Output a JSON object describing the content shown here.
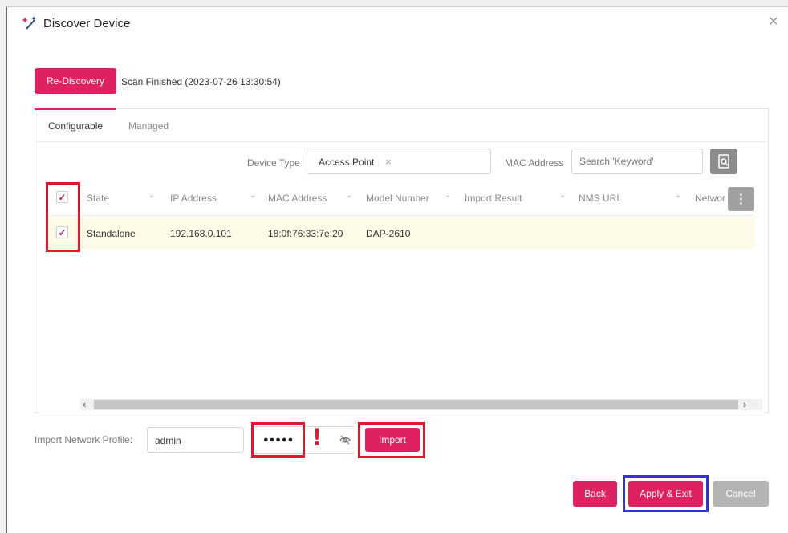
{
  "dialog": {
    "title": "Discover Device",
    "close_icon": "×"
  },
  "rediscovery_label": "Re-Discovery",
  "scan_status": "Scan Finished (2023-07-26 13:30:54)",
  "tabs": [
    {
      "label": "Configurable"
    },
    {
      "label": "Managed"
    }
  ],
  "filters": {
    "device_type_label": "Device Type",
    "device_type_value": "Access Point",
    "mac_label": "MAC Address",
    "search_placeholder": "Search 'Keyword'"
  },
  "table": {
    "columns": [
      "State",
      "IP Address",
      "MAC Address",
      "Model Number",
      "Import Result",
      "NMS URL",
      "Networ"
    ],
    "rows": [
      {
        "state": "Standalone",
        "ip": "192.168.0.101",
        "mac": "18:0f:76:33:7e:20",
        "model": "DAP-2610",
        "checked": true
      }
    ]
  },
  "import": {
    "label": "Import Network Profile:",
    "username": "admin",
    "password_mask": "●●●●●",
    "warning": "!",
    "button": "Import"
  },
  "footer": {
    "back": "Back",
    "apply": "Apply & Exit",
    "cancel": "Cancel"
  },
  "colors": {
    "accent": "#e0215f",
    "highlight_red": "#e1162b",
    "highlight_blue": "#3036c9"
  }
}
